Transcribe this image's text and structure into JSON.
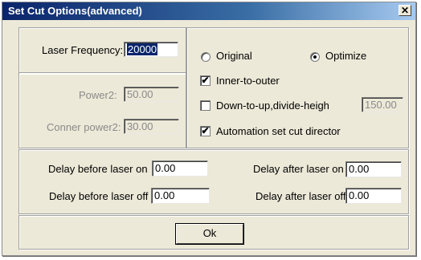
{
  "window": {
    "title": "Set Cut Options(advanced)",
    "close_glyph": "✕"
  },
  "laser": {
    "frequency_label": "Laser Frequency:",
    "frequency_value": "20000"
  },
  "power": {
    "power2_label": "Power2:",
    "power2_value": "50.00",
    "corner_label": "Conner power2:",
    "corner_value": "30.00"
  },
  "options": {
    "original_label": "Original",
    "optimize_label": "Optimize",
    "selected_mode": "Optimize",
    "inner_to_outer_label": "Inner-to-outer",
    "inner_to_outer_checked": true,
    "down_to_up_label": "Down-to-up,divide-heigh",
    "down_to_up_checked": false,
    "divide_height_value": "150.00",
    "automation_label": "Automation set cut director",
    "automation_checked": true
  },
  "delays": {
    "before_on_label": "Delay before laser on",
    "before_on_value": "0.00",
    "after_on_label": "Delay after laser on",
    "after_on_value": "0.00",
    "before_off_label": "Delay before laser off",
    "before_off_value": "0.00",
    "after_off_label": "Delay after laser off",
    "after_off_value": "0.00"
  },
  "footer": {
    "ok_label": "Ok"
  }
}
